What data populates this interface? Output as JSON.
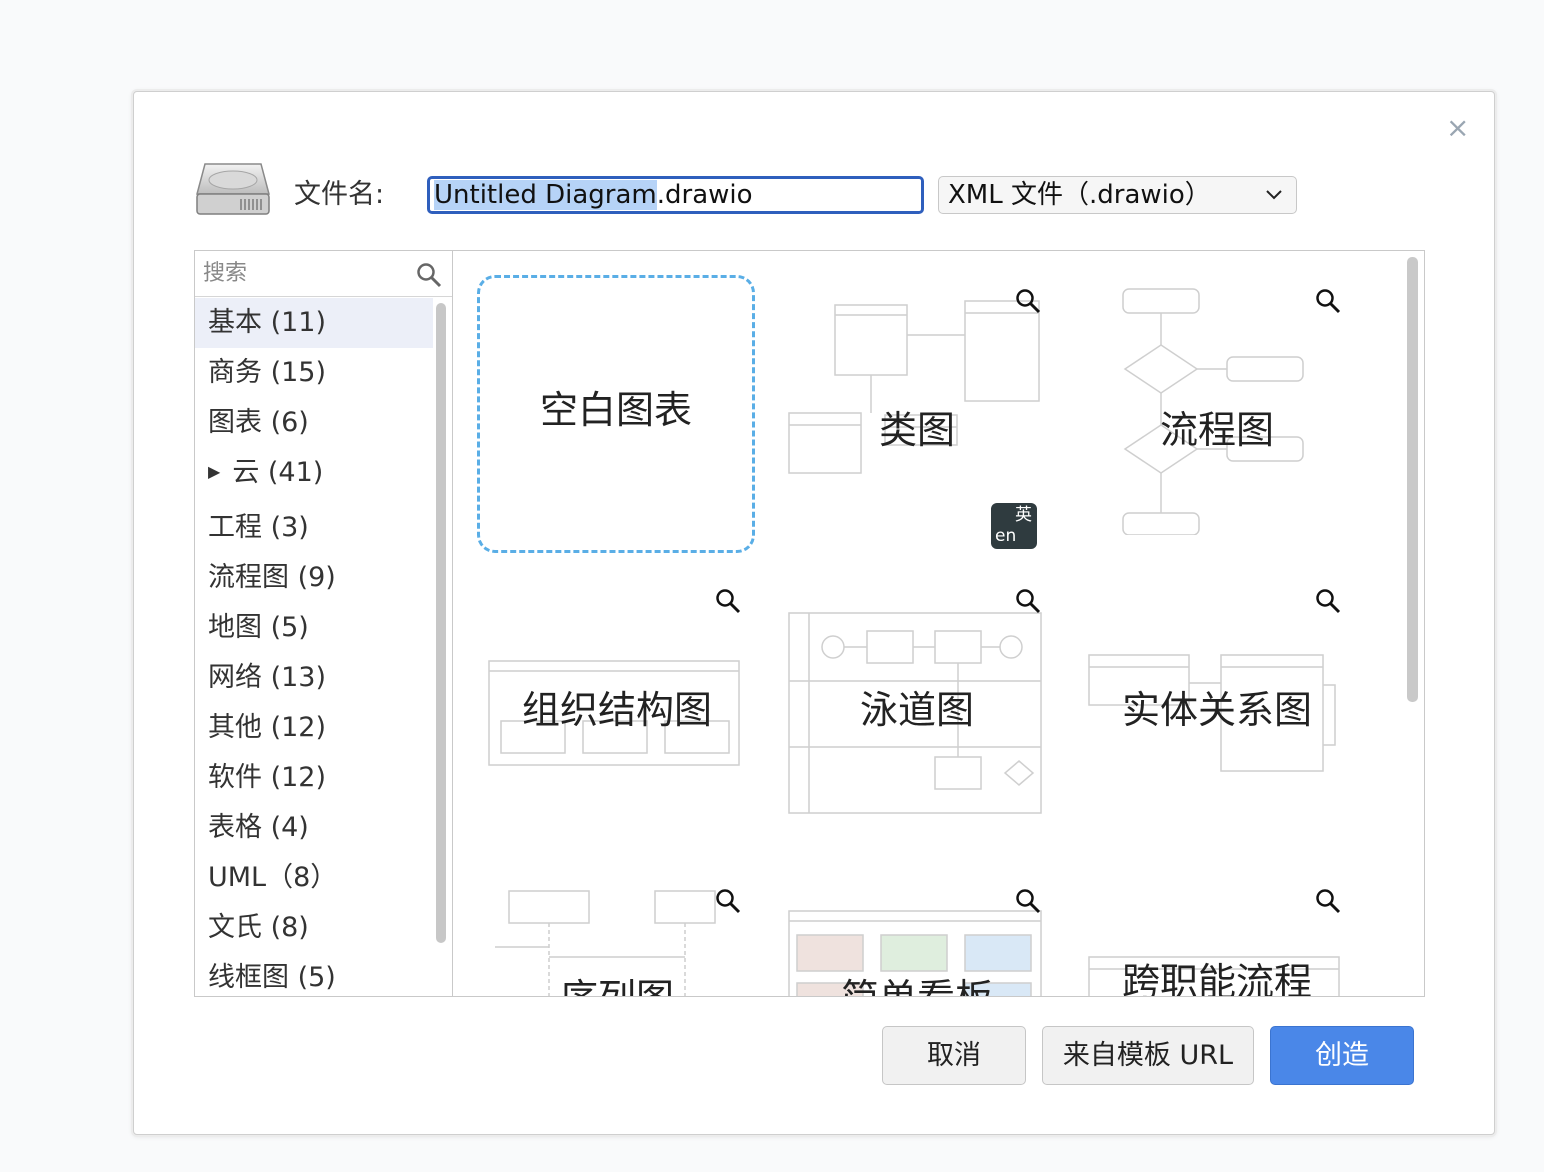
{
  "dialog": {
    "close_glyph": "×",
    "filename_label": "文件名:",
    "filename_value_selected": "Untitled Diagram",
    "filename_value_rest": ".drawio",
    "format_value": "XML 文件（.drawio）",
    "search_placeholder": "搜索"
  },
  "categories": [
    {
      "label": "基本 (11)",
      "active": true
    },
    {
      "label": "商务 (15)"
    },
    {
      "label": "图表 (6)"
    },
    {
      "label": "云 (41)",
      "expandable": true,
      "arrow": "▶"
    },
    {
      "label": "工程 (3)"
    },
    {
      "label": "流程图 (9)"
    },
    {
      "label": "地图 (5)"
    },
    {
      "label": "网络 (13)"
    },
    {
      "label": "其他 (12)"
    },
    {
      "label": "软件 (12)"
    },
    {
      "label": "表格 (4)"
    },
    {
      "label": "UML（8）"
    },
    {
      "label": "文氏 (8)"
    },
    {
      "label": "线框图 (5)"
    }
  ],
  "templates": [
    {
      "label": "空白图表"
    },
    {
      "label": "类图"
    },
    {
      "label": "流程图"
    },
    {
      "label": "组织结构图"
    },
    {
      "label": "泳道图"
    },
    {
      "label": "实体关系图"
    },
    {
      "label": "序列图"
    },
    {
      "label": "简单看板"
    },
    {
      "label": "跨职能流程"
    }
  ],
  "translate_badge": {
    "top": "英",
    "bottom": "en"
  },
  "buttons": {
    "cancel": "取消",
    "from_template_url": "来自模板 URL",
    "create": "创造"
  },
  "colors": {
    "accent": "#4a87e8",
    "selection": "#b6d3f7",
    "blank_border": "#5aaee6"
  }
}
